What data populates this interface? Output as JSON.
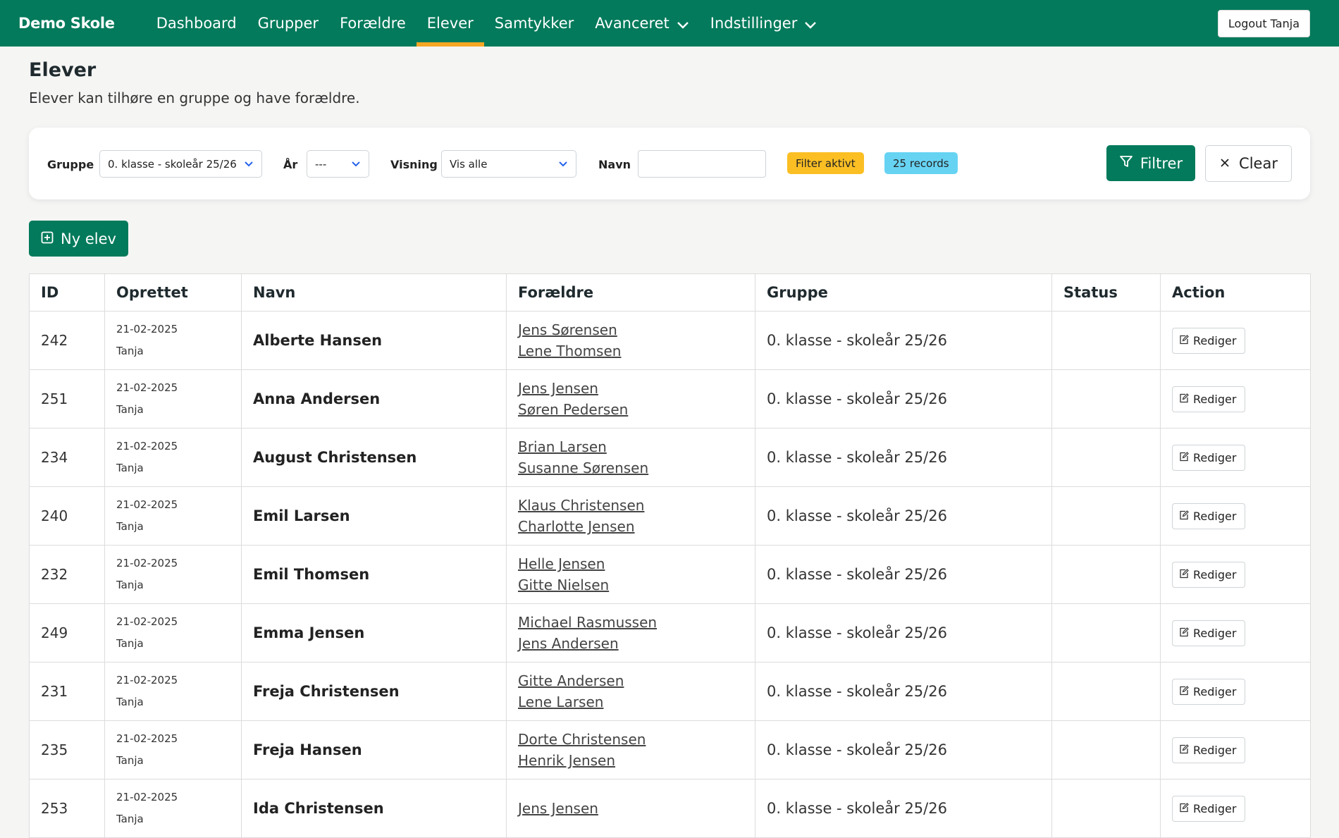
{
  "app": {
    "brand": "Demo Skole",
    "logout_label": "Logout Tanja"
  },
  "nav": {
    "items": [
      {
        "label": "Dashboard"
      },
      {
        "label": "Grupper"
      },
      {
        "label": "Forældre"
      },
      {
        "label": "Elever"
      },
      {
        "label": "Samtykker"
      },
      {
        "label": "Avanceret"
      },
      {
        "label": "Indstillinger"
      }
    ],
    "active": "Elever"
  },
  "page": {
    "title": "Elever",
    "subtitle": "Elever kan tilhøre en gruppe og have forældre."
  },
  "filters": {
    "group_label": "Gruppe",
    "group_value": "0. klasse - skoleår 25/26",
    "year_label": "År",
    "year_value": "---",
    "view_label": "Visning",
    "view_value": "Vis alle",
    "name_label": "Navn",
    "name_value": "",
    "badge_active": "Filter aktivt",
    "badge_records": "25 records",
    "filter_button": "Filtrer",
    "clear_button": "Clear"
  },
  "actions": {
    "new_button": "Ny elev"
  },
  "table": {
    "headers": [
      "ID",
      "Oprettet",
      "Navn",
      "Forældre",
      "Gruppe",
      "Status",
      "Action"
    ],
    "edit_label": "Rediger",
    "rows": [
      {
        "id": "242",
        "date": "21-02-2025",
        "by": "Tanja",
        "name": "Alberte Hansen",
        "parents": [
          "Jens Sørensen",
          "Lene Thomsen"
        ],
        "group": "0. klasse - skoleår 25/26",
        "status": ""
      },
      {
        "id": "251",
        "date": "21-02-2025",
        "by": "Tanja",
        "name": "Anna Andersen",
        "parents": [
          "Jens Jensen",
          "Søren Pedersen"
        ],
        "group": "0. klasse - skoleår 25/26",
        "status": ""
      },
      {
        "id": "234",
        "date": "21-02-2025",
        "by": "Tanja",
        "name": "August Christensen",
        "parents": [
          "Brian Larsen",
          "Susanne Sørensen"
        ],
        "group": "0. klasse - skoleår 25/26",
        "status": ""
      },
      {
        "id": "240",
        "date": "21-02-2025",
        "by": "Tanja",
        "name": "Emil Larsen",
        "parents": [
          "Klaus Christensen",
          "Charlotte Jensen"
        ],
        "group": "0. klasse - skoleår 25/26",
        "status": ""
      },
      {
        "id": "232",
        "date": "21-02-2025",
        "by": "Tanja",
        "name": "Emil Thomsen",
        "parents": [
          "Helle Jensen",
          "Gitte Nielsen"
        ],
        "group": "0. klasse - skoleår 25/26",
        "status": ""
      },
      {
        "id": "249",
        "date": "21-02-2025",
        "by": "Tanja",
        "name": "Emma Jensen",
        "parents": [
          "Michael Rasmussen",
          "Jens Andersen"
        ],
        "group": "0. klasse - skoleår 25/26",
        "status": ""
      },
      {
        "id": "231",
        "date": "21-02-2025",
        "by": "Tanja",
        "name": "Freja Christensen",
        "parents": [
          "Gitte Andersen",
          "Lene Larsen"
        ],
        "group": "0. klasse - skoleår 25/26",
        "status": ""
      },
      {
        "id": "235",
        "date": "21-02-2025",
        "by": "Tanja",
        "name": "Freja Hansen",
        "parents": [
          "Dorte Christensen",
          "Henrik Jensen"
        ],
        "group": "0. klasse - skoleår 25/26",
        "status": ""
      },
      {
        "id": "253",
        "date": "21-02-2025",
        "by": "Tanja",
        "name": "Ida Christensen",
        "parents": [
          "Jens Jensen",
          ""
        ],
        "group": "0. klasse - skoleår 25/26",
        "status": ""
      }
    ]
  },
  "colors": {
    "primary": "#027a5b",
    "active_underline": "#f5a623",
    "badge_warn": "#fbbf24",
    "badge_info": "#67d3f3"
  }
}
